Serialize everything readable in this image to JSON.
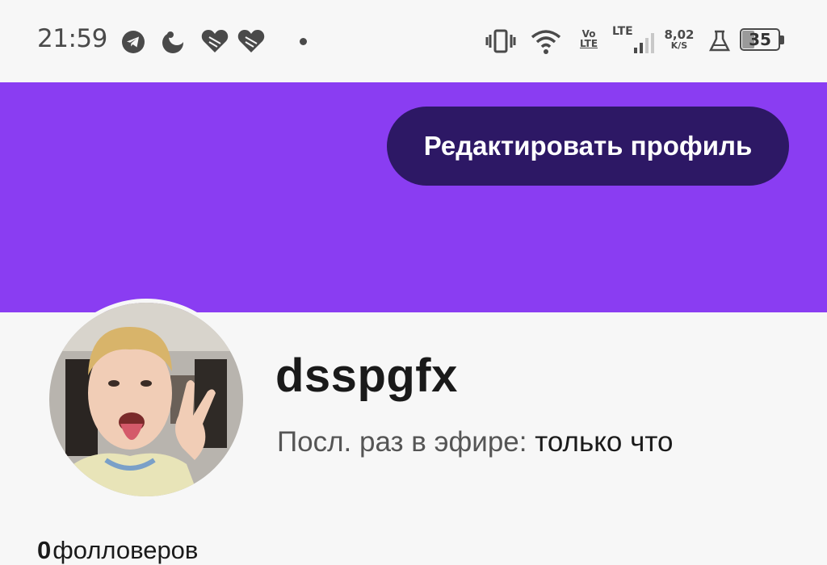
{
  "status_bar": {
    "time": "21:59",
    "notification_icons": [
      "telegram-icon",
      "moon-icon",
      "heart-icon",
      "heart-icon",
      "heart-icon"
    ],
    "system_icons": [
      "vibrate-icon",
      "wifi-icon",
      "volte-icon",
      "lte-signal-icon",
      "network-speed",
      "alarm-icon",
      "battery-icon"
    ],
    "volte_top": "Vo",
    "volte_bottom": "LTE",
    "lte_label": "LTE",
    "speed_value": "8,02",
    "speed_unit": "K/S",
    "battery_level": "35",
    "battery_fraction": 0.35
  },
  "header": {
    "banner_color": "#8a3df2",
    "edit_profile_label": "Редактировать профиль"
  },
  "profile": {
    "username": "dsspgfx",
    "last_seen_label": "Посл. раз в эфире:",
    "last_seen_value": "только что"
  },
  "stats": {
    "followers_count": "0",
    "followers_label": "фолловеров"
  }
}
